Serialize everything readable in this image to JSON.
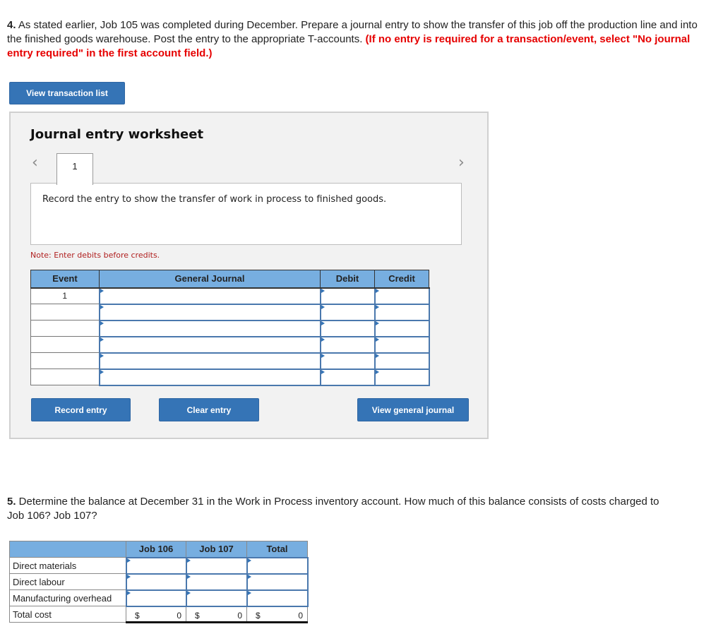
{
  "question4": {
    "number": "4.",
    "text": " As stated earlier, Job 105 was completed during December. Prepare a journal entry to show the transfer of this job off the production line and into the finished goods warehouse. Post the entry to the appropriate T-accounts. ",
    "instruction": "(If no entry is required for a transaction/event, select \"No journal entry required\" in the first account field.)"
  },
  "view_transaction_list_label": "View transaction list",
  "worksheet": {
    "title": "Journal entry worksheet",
    "prev_icon": "chevron-left-icon",
    "next_icon": "chevron-right-icon",
    "current_tab": "1",
    "description": "Record the entry to show the transfer of work in process to finished goods.",
    "note": "Note: Enter debits before credits.",
    "table": {
      "headers": [
        "Event",
        "General Journal",
        "Debit",
        "Credit"
      ],
      "rows": [
        {
          "event": "1",
          "account": "",
          "debit": "",
          "credit": ""
        },
        {
          "event": "",
          "account": "",
          "debit": "",
          "credit": ""
        },
        {
          "event": "",
          "account": "",
          "debit": "",
          "credit": ""
        },
        {
          "event": "",
          "account": "",
          "debit": "",
          "credit": ""
        },
        {
          "event": "",
          "account": "",
          "debit": "",
          "credit": ""
        },
        {
          "event": "",
          "account": "",
          "debit": "",
          "credit": ""
        }
      ]
    },
    "buttons": {
      "record": "Record entry",
      "clear": "Clear entry",
      "view_general_journal": "View general journal"
    }
  },
  "question5": {
    "number": "5.",
    "text": " Determine the balance at December 31 in the Work in Process inventory account. How much of this balance consists of costs charged to Job 106? Job 107?"
  },
  "cost_table": {
    "headers": [
      "",
      "Job 106",
      "Job 107",
      "Total"
    ],
    "rows": [
      {
        "label": "Direct materials",
        "job106": "",
        "job107": "",
        "total": ""
      },
      {
        "label": "Direct labour",
        "job106": "",
        "job107": "",
        "total": ""
      },
      {
        "label": "Manufacturing overhead",
        "job106": "",
        "job107": "",
        "total": ""
      }
    ],
    "total_row": {
      "label": "Total cost",
      "currency": "$",
      "job106": "0",
      "job107": "0",
      "total": "0"
    }
  }
}
